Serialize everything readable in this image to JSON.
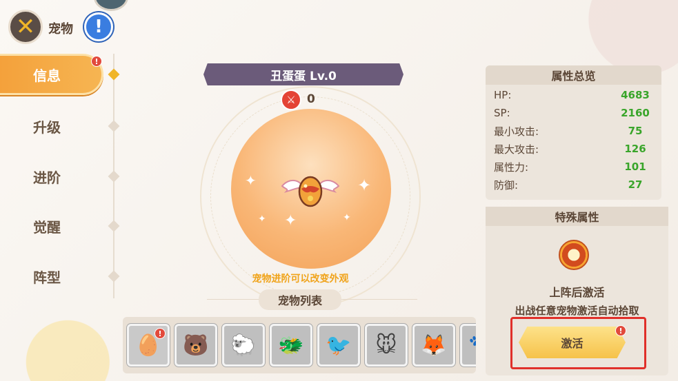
{
  "header": {
    "title": "宠物",
    "back_icon": "close-x-icon",
    "help_icon": "exclamation-icon"
  },
  "sidebar": {
    "items": [
      {
        "label": "信息",
        "active": true,
        "badge": "!"
      },
      {
        "label": "升级"
      },
      {
        "label": "进阶"
      },
      {
        "label": "觉醒"
      },
      {
        "label": "阵型"
      }
    ]
  },
  "pet": {
    "name": "丑蛋蛋 Lv.0",
    "power_value": "0",
    "hint": "宠物进阶可以改变外观"
  },
  "pet_list": {
    "title": "宠物列表",
    "badge": "!",
    "count_visible": 8
  },
  "attributes": {
    "title": "属性总览",
    "rows": [
      {
        "label": "HP:",
        "value": "4683"
      },
      {
        "label": "SP:",
        "value": "2160"
      },
      {
        "label": "最小攻击:",
        "value": "75"
      },
      {
        "label": "最大攻击:",
        "value": "126"
      },
      {
        "label": "属性力:",
        "value": "101"
      },
      {
        "label": "防御:",
        "value": "27"
      }
    ]
  },
  "special": {
    "title": "特殊属性",
    "effect_title": "上阵后激活",
    "effect_desc": "出战任意宠物激活自动拾取",
    "activate_label": "激活",
    "badge": "!"
  },
  "colors": {
    "accent_orange": "#f4a13b",
    "value_green": "#39a52a",
    "hint_orange": "#f0a31a",
    "highlight_red": "#e0302a"
  }
}
